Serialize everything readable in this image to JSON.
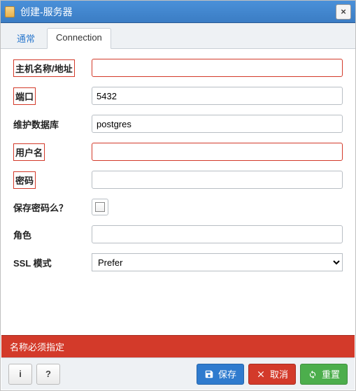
{
  "titlebar": {
    "title": "创建-服务器"
  },
  "tabs": {
    "general": "通常",
    "connection": "Connection"
  },
  "form": {
    "host_label": "主机名称/地址",
    "host_value": "",
    "port_label": "端口",
    "port_value": "5432",
    "maintdb_label": "维护数据库",
    "maintdb_value": "postgres",
    "user_label": "用户名",
    "user_value": "",
    "password_label": "密码",
    "password_value": "",
    "savepw_label": "保存密码么？",
    "role_label": "角色",
    "role_value": "",
    "sslmode_label": "SSL 模式",
    "sslmode_value": "Prefer"
  },
  "error": "名称必须指定",
  "footer": {
    "save": "保存",
    "cancel": "取消",
    "reset": "重置"
  }
}
